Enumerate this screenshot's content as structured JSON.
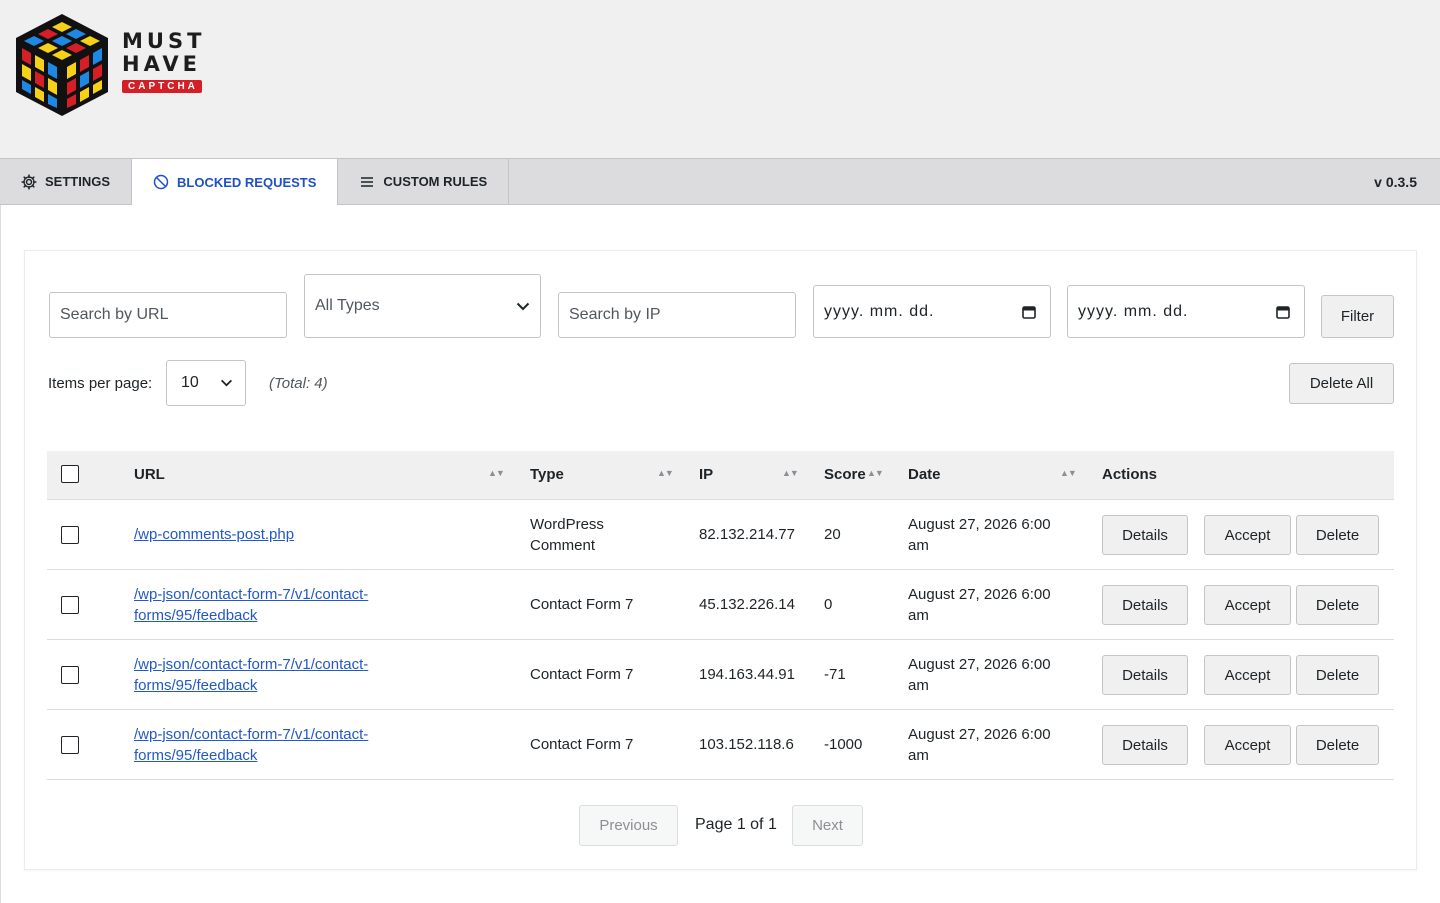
{
  "brand": {
    "line1": "MUST",
    "line2": "HAVE",
    "badge": "CAPTCHA",
    "colors": {
      "red": "#d41f26",
      "yellow": "#f7d117",
      "blue": "#1e88e5",
      "black": "#111111"
    }
  },
  "tabs": [
    {
      "label": "Settings",
      "icon": "gear-icon"
    },
    {
      "label": "Blocked Requests",
      "icon": "block-icon",
      "active": true
    },
    {
      "label": "Custom Rules",
      "icon": "menu-icon"
    }
  ],
  "version": "v 0.3.5",
  "filters": {
    "url_placeholder": "Search by URL",
    "type_selected": "All Types",
    "ip_placeholder": "Search by IP",
    "date_from_placeholder": "yyyy. mm. dd.",
    "date_to_placeholder": "yyyy. mm. dd.",
    "filter_label": "Filter"
  },
  "paging_controls": {
    "items_label": "Items per page:",
    "items_value": "10",
    "total_text": "(Total: 4)",
    "delete_all_label": "Delete All"
  },
  "table": {
    "columns": [
      "URL",
      "Type",
      "IP",
      "Score",
      "Date",
      "Actions"
    ],
    "rows": [
      {
        "url1": "/wp-comments-post.php",
        "url2": "",
        "type1": "WordPress",
        "type2": "Comment",
        "ip": "82.132.214.77",
        "score": "20",
        "date1": "August 27, 2026 6:00",
        "date2": "am"
      },
      {
        "url1": "/wp-json/contact-form-7/v1/contact-",
        "url2": "forms/95/feedback",
        "type1": "Contact Form 7",
        "type2": "",
        "ip": "45.132.226.14",
        "score": "0",
        "date1": "August 27, 2026 6:00",
        "date2": "am"
      },
      {
        "url1": "/wp-json/contact-form-7/v1/contact-",
        "url2": "forms/95/feedback",
        "type1": "Contact Form 7",
        "type2": "",
        "ip": "194.163.44.91",
        "score": "-71",
        "date1": "August 27, 2026 6:00",
        "date2": "am"
      },
      {
        "url1": "/wp-json/contact-form-7/v1/contact-",
        "url2": "forms/95/feedback",
        "type1": "Contact Form 7",
        "type2": "",
        "ip": "103.152.118.6",
        "score": "-1000",
        "date1": "August 27, 2026 6:00",
        "date2": "am"
      }
    ],
    "actions": {
      "details": "Details",
      "accept": "Accept",
      "delete": "Delete"
    }
  },
  "pagination": {
    "previous": "Previous",
    "page_text": "Page 1 of 1",
    "next": "Next"
  }
}
